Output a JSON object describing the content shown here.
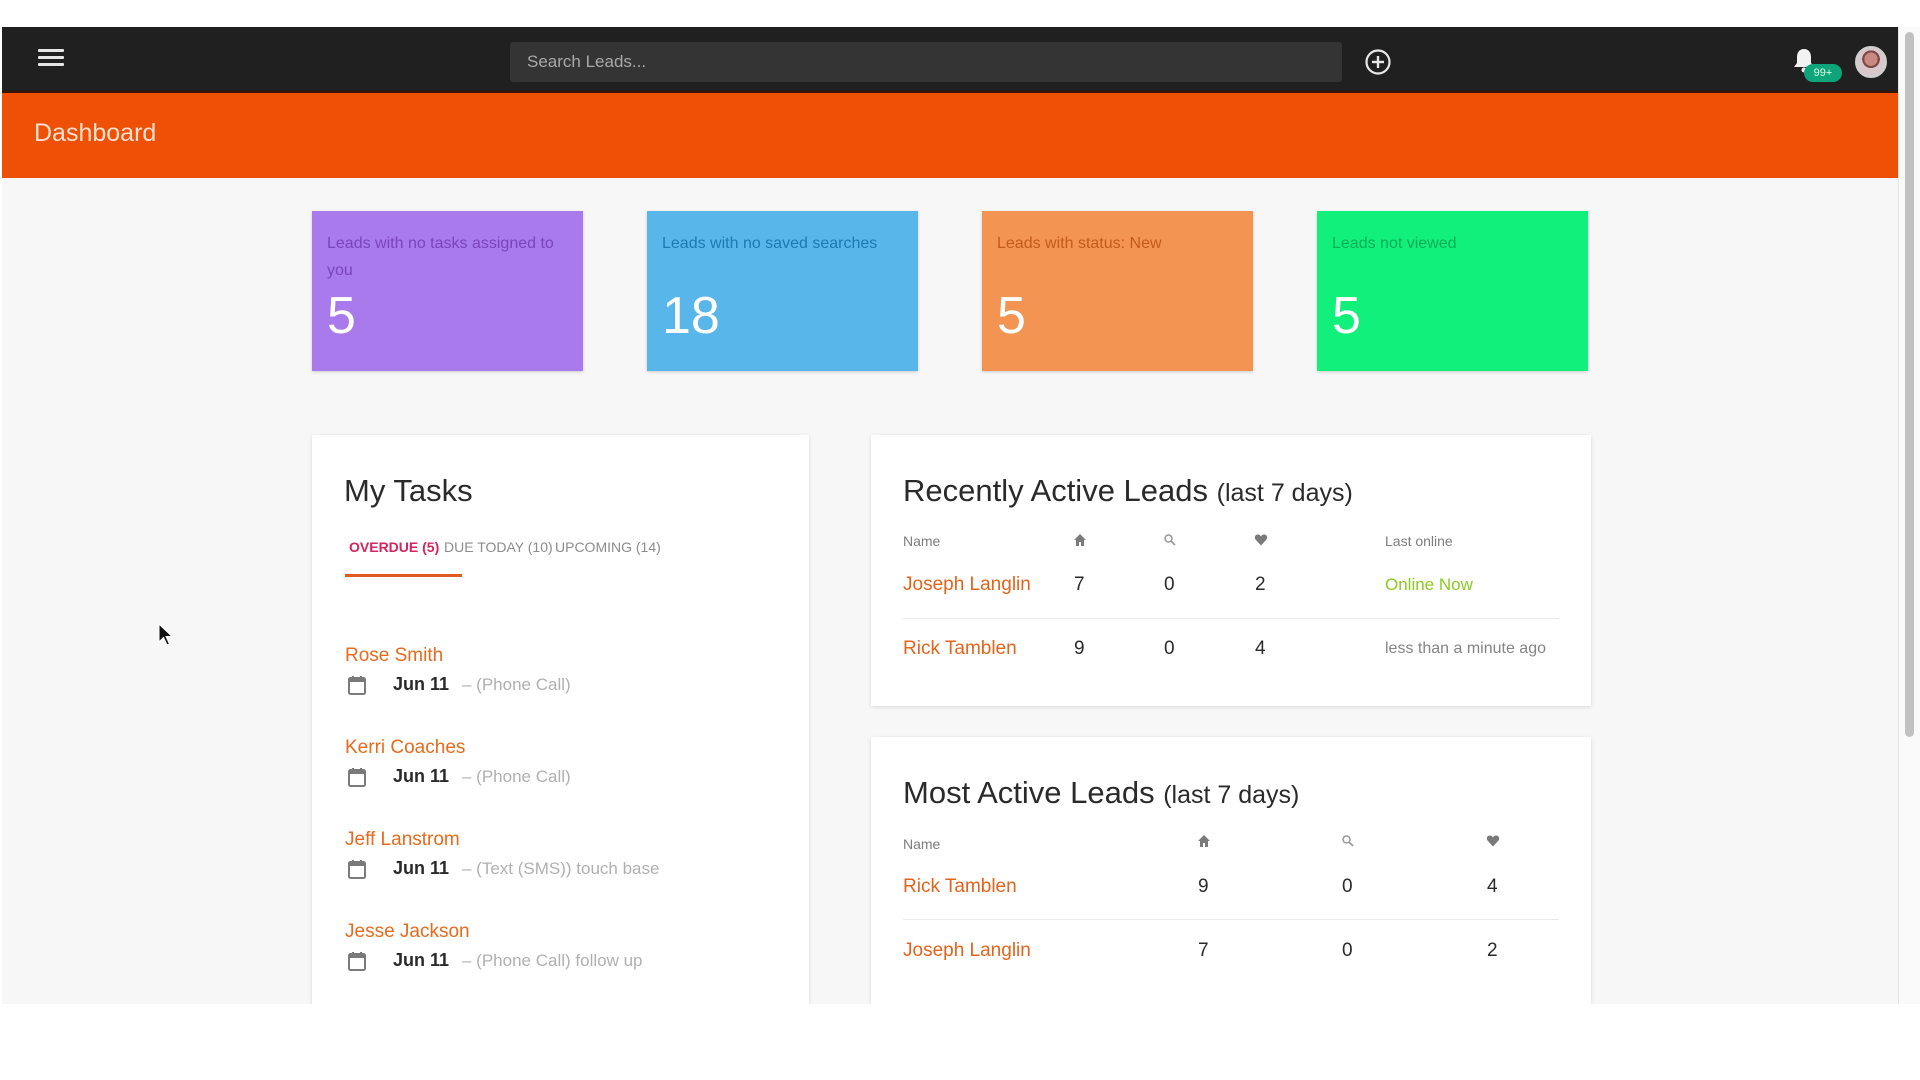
{
  "navbar": {
    "menu_icon": "hamburger-menu-icon",
    "search_placeholder": "Search Leads...",
    "search_value": "",
    "add_icon": "plus-circle-icon",
    "notification_icon": "bell-icon",
    "notification_badge": "99+",
    "avatar_icon": "user-avatar"
  },
  "header": {
    "title": "Dashboard"
  },
  "stats": [
    {
      "label": "Leads with no tasks assigned to you",
      "value": "5",
      "color": "#a97aec"
    },
    {
      "label": "Leads with no saved searches",
      "value": "18",
      "color": "#58b6ea"
    },
    {
      "label": "Leads with status: New",
      "value": "5",
      "color": "#f39453"
    },
    {
      "label": "Leads not viewed",
      "value": "5",
      "color": "#12f07c"
    }
  ],
  "tasks": {
    "title": "My Tasks",
    "tabs": [
      {
        "label": "OVERDUE (5)",
        "active": true
      },
      {
        "label": "DUE TODAY (10)",
        "active": false
      },
      {
        "label": "UPCOMING (14)",
        "active": false
      }
    ],
    "items": [
      {
        "name": "Rose Smith",
        "date": "Jun 11",
        "desc": "– (Phone Call)"
      },
      {
        "name": "Kerri Coaches",
        "date": "Jun 11",
        "desc": "– (Phone Call)"
      },
      {
        "name": "Jeff Lanstrom",
        "date": "Jun 11",
        "desc": "– (Text (SMS)) touch base"
      },
      {
        "name": "Jesse Jackson",
        "date": "Jun 11",
        "desc": "– (Phone Call) follow up"
      }
    ]
  },
  "recent_leads": {
    "title": "Recently Active Leads",
    "subtitle": "(last 7 days)",
    "columns": {
      "name": "Name",
      "icons": [
        "home-icon",
        "search-icon",
        "heart-icon"
      ],
      "last_online": "Last online"
    },
    "rows": [
      {
        "name": "Joseph Langlin",
        "homes": "7",
        "searches": "0",
        "favorites": "2",
        "last_online": "Online Now"
      },
      {
        "name": "Rick Tamblen",
        "homes": "9",
        "searches": "0",
        "favorites": "4",
        "last_online": "less than a minute ago"
      }
    ]
  },
  "most_active_leads": {
    "title": "Most Active Leads",
    "subtitle": "(last 7 days)",
    "columns": {
      "name": "Name",
      "icons": [
        "home-icon",
        "search-icon",
        "heart-icon"
      ]
    },
    "rows": [
      {
        "name": "Rick Tamblen",
        "homes": "9",
        "searches": "0",
        "favorites": "4"
      },
      {
        "name": "Joseph Langlin",
        "homes": "7",
        "searches": "0",
        "favorites": "2"
      }
    ]
  },
  "colors": {
    "navbar": "#1f201f",
    "brand_orange": "#ee5005",
    "lead_link": "#e4631b",
    "active_tab": "#d6245c",
    "online": "#8acb1f"
  }
}
